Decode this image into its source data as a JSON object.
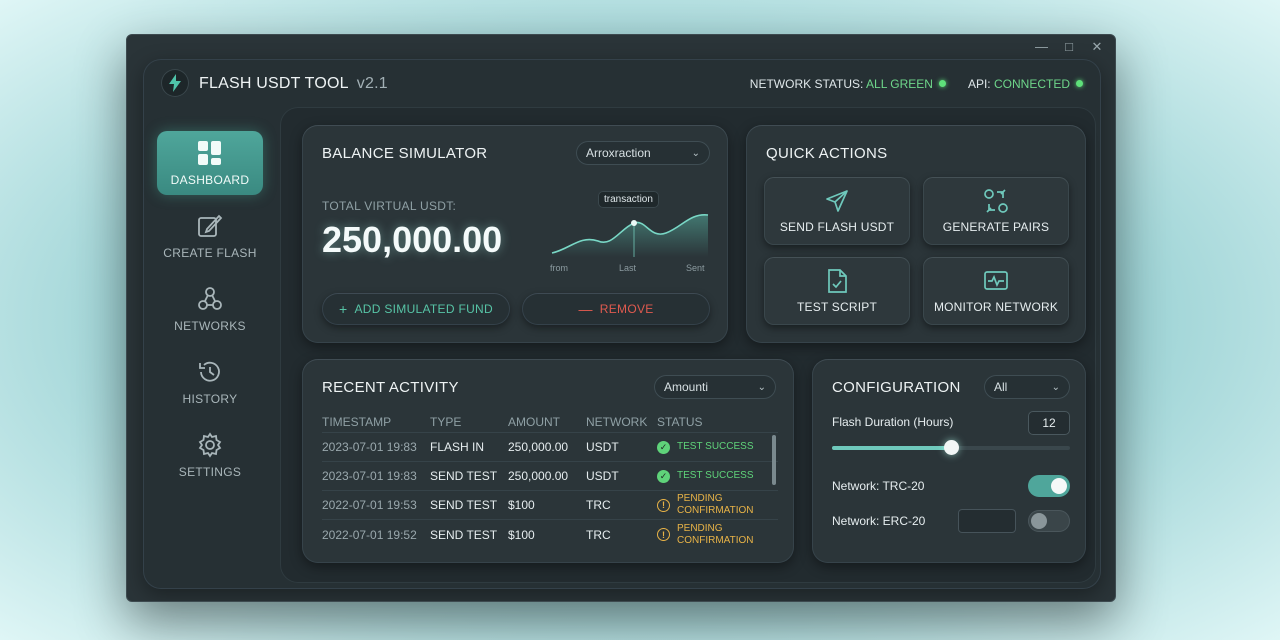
{
  "window": {
    "controls": [
      "—",
      "□",
      "✕"
    ]
  },
  "header": {
    "title": "FLASH USDT TOOL",
    "version": "v2.1",
    "network_status_label": "NETWORK STATUS:",
    "network_status_value": "ALL GREEN",
    "api_label": "API:",
    "api_value": "CONNECTED"
  },
  "sidebar": {
    "items": [
      {
        "label": "DASHBOARD",
        "icon": "dashboard-icon",
        "active": true
      },
      {
        "label": "CREATE FLASH",
        "icon": "edit-icon",
        "active": false
      },
      {
        "label": "NETWORKS",
        "icon": "network-icon",
        "active": false
      },
      {
        "label": "HISTORY",
        "icon": "history-icon",
        "active": false
      },
      {
        "label": "SETTINGS",
        "icon": "gear-icon",
        "active": false
      }
    ]
  },
  "balance": {
    "title": "BALANCE SIMULATOR",
    "select_value": "Arroxraction",
    "total_label": "TOTAL VIRTUAL USDT:",
    "total_value": "250,000.00",
    "chart_tooltip": "transaction",
    "chart_x_labels": [
      "from",
      "Last",
      "Sent"
    ],
    "add_button": "ADD SIMULATED FUND",
    "remove_button": "REMOVE"
  },
  "quick_actions": {
    "title": "QUICK ACTIONS",
    "items": [
      {
        "label": "SEND FLASH USDT",
        "icon": "send-icon"
      },
      {
        "label": "GENERATE PAIRS",
        "icon": "pairs-icon"
      },
      {
        "label": "TEST SCRIPT",
        "icon": "script-icon"
      },
      {
        "label": "MONITOR NETWORK",
        "icon": "monitor-icon"
      }
    ]
  },
  "activity": {
    "title": "RECENT ACTIVITY",
    "select_value": "Amounti",
    "columns": [
      "TIMESTAMP",
      "TYPE",
      "AMOUNT",
      "NETWORK",
      "STATUS"
    ],
    "rows": [
      {
        "timestamp": "2023-07-01 19:83",
        "type": "FLASH IN",
        "amount": "250,000.00",
        "network": "USDT",
        "status": "TEST SUCCESS",
        "status_kind": "ok"
      },
      {
        "timestamp": "2023-07-01 19:83",
        "type": "SEND TEST",
        "amount": "250,000.00",
        "network": "USDT",
        "status": "TEST SUCCESS",
        "status_kind": "ok"
      },
      {
        "timestamp": "2022-07-01 19:53",
        "type": "SEND TEST",
        "amount": "$100",
        "network": "TRC",
        "status": "PENDING CONFIRMATION",
        "status_kind": "pending"
      },
      {
        "timestamp": "2022-07-01 19:52",
        "type": "SEND TEST",
        "amount": "$100",
        "network": "TRC",
        "status": "PENDING CONFIRMATION",
        "status_kind": "pending"
      }
    ]
  },
  "config": {
    "title": "CONFIGURATION",
    "select_value": "All",
    "duration_label": "Flash Duration (Hours)",
    "duration_value": "12",
    "duration_slider_fraction": 0.5,
    "trc_label": "Network: TRC-20",
    "trc_enabled": true,
    "erc_label": "Network: ERC-20",
    "erc_enabled": false
  },
  "colors": {
    "accent": "#4fa69b",
    "success": "#5fd37a",
    "pending": "#e8b347",
    "danger": "#e05a4f",
    "status_green": "#6ed68a"
  }
}
